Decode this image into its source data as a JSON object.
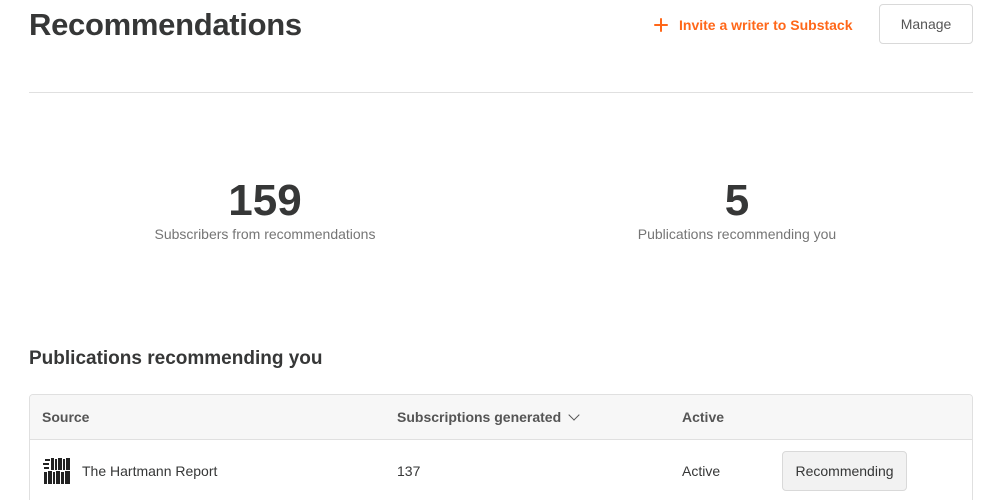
{
  "header": {
    "title": "Recommendations",
    "invite_label": "Invite a writer to Substack",
    "manage_label": "Manage"
  },
  "colors": {
    "accent": "#ff6719",
    "text": "#363737",
    "muted": "#757575",
    "border": "#e0e0e0"
  },
  "stats": [
    {
      "value": "159",
      "label": "Subscribers from recommendations"
    },
    {
      "value": "5",
      "label": "Publications recommending you"
    }
  ],
  "section": {
    "title": "Publications recommending you"
  },
  "table": {
    "columns": {
      "source": "Source",
      "subscriptions": "Subscriptions generated",
      "active": "Active"
    },
    "sort_icon": "chevron-down-icon",
    "rows": [
      {
        "publication": "The Hartmann Report",
        "logo_icon": "publication-logo-icon",
        "subscriptions": "137",
        "active": "Active",
        "action_label": "Recommending"
      }
    ]
  }
}
